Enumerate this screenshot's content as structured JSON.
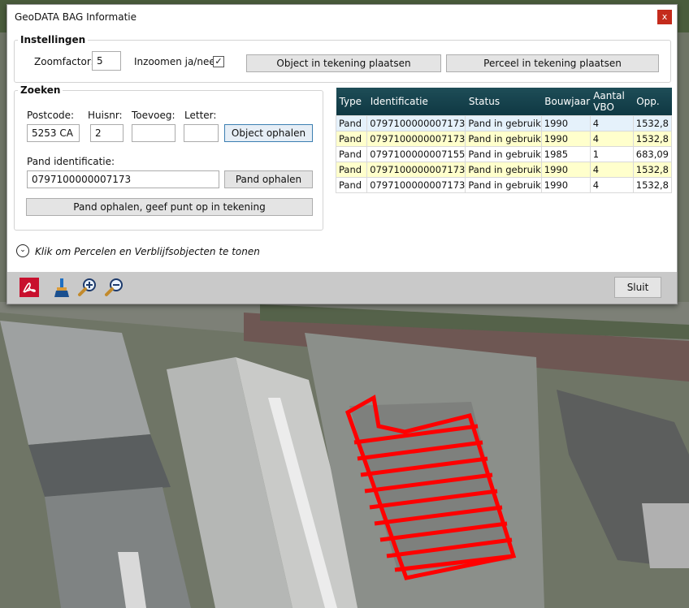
{
  "window": {
    "title": "GeoDATA   BAG Informatie",
    "close": "x"
  },
  "instellingen": {
    "legend": "Instellingen",
    "zoomfactor_label": "Zoomfactor:",
    "zoomfactor_value": "5",
    "inzoomen_label": "Inzoomen ja/nee:",
    "inzoomen_checked": "✓",
    "btn_object_plaatsen": "Object in tekening plaatsen",
    "btn_perceel_plaatsen": "Perceel in tekening plaatsen"
  },
  "zoeken": {
    "legend": "Zoeken",
    "postcode_label": "Postcode:",
    "postcode_value": "5253 CA",
    "huisnr_label": "Huisnr:",
    "huisnr_value": "2",
    "toevoeg_label": "Toevoeg:",
    "toevoeg_value": "",
    "letter_label": "Letter:",
    "letter_value": "",
    "btn_object_ophalen": "Object ophalen",
    "pand_id_label": "Pand identificatie:",
    "pand_id_value": "0797100000007173",
    "btn_pand_ophalen": "Pand ophalen",
    "btn_pand_punt": "Pand ophalen, geef punt op in tekening"
  },
  "table": {
    "headers": [
      "Type",
      "Identificatie",
      "Status",
      "Bouwjaar",
      "Aantal VBO",
      "Opp."
    ],
    "rows": [
      [
        "Pand",
        "0797100000007173",
        "Pand in gebruik",
        "1990",
        "4",
        "1532,8"
      ],
      [
        "Pand",
        "0797100000007173",
        "Pand in gebruik",
        "1990",
        "4",
        "1532,8"
      ],
      [
        "Pand",
        "0797100000007155",
        "Pand in gebruik",
        "1985",
        "1",
        "683,09"
      ],
      [
        "Pand",
        "0797100000007173",
        "Pand in gebruik",
        "1990",
        "4",
        "1532,8"
      ],
      [
        "Pand",
        "0797100000007173",
        "Pand in gebruik",
        "1990",
        "4",
        "1532,8"
      ]
    ]
  },
  "expander": {
    "label": "Klik om Percelen en Verblijfsobjecten te tonen"
  },
  "toolbar": {
    "icons": [
      "pdf-icon",
      "brush-icon",
      "zoom-in-icon",
      "zoom-out-icon"
    ],
    "sluit": "Sluit"
  },
  "colors": {
    "grid_header": "#163f4a",
    "row_highlight": "#ffffcc",
    "selection": "#e5f1fb",
    "pand_outline": "#ff0000"
  }
}
